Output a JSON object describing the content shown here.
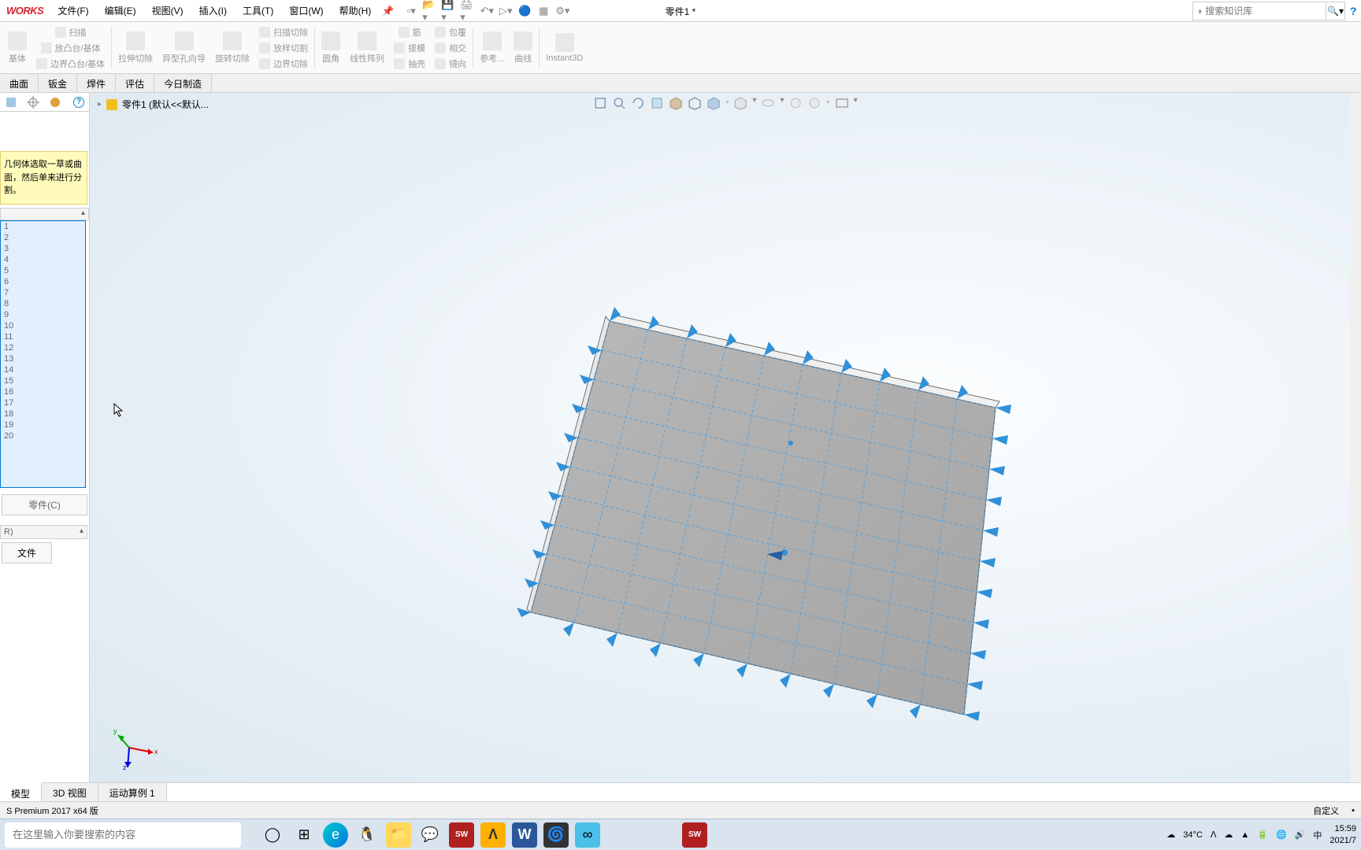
{
  "logo": "WORKS",
  "menu": [
    "文件(F)",
    "编辑(E)",
    "视图(V)",
    "插入(I)",
    "工具(T)",
    "窗口(W)",
    "帮助(H)"
  ],
  "pin": "📌",
  "doc_title": "零件1 *",
  "search": {
    "placeholder": "搜索知识库"
  },
  "ribbon": {
    "c1": [
      "扫描",
      "放凸台/基体",
      "边界凸台/基体"
    ],
    "c2": "拉伸切除",
    "c3": "异型孔向导",
    "c4": "旋转切除",
    "c5": [
      "扫描切除",
      "放样切割",
      "边界切除"
    ],
    "c6": "圆角",
    "c7": "线性阵列",
    "c8": [
      "筋",
      "拔模",
      "抽壳"
    ],
    "c9": [
      "包覆",
      "相交",
      "镜向"
    ],
    "c10": "参考...",
    "c11": "曲线",
    "c12": "Instant3D"
  },
  "ftabs": [
    "曲面",
    "钣金",
    "焊件",
    "评估",
    "今日制造"
  ],
  "crumb": "零件1 (默认<<默认...",
  "info": "几何体选取一草或曲面，然后单来进行分割。",
  "items": [
    "1",
    "2",
    "3",
    "4",
    "5",
    "6",
    "7",
    "8",
    "9",
    "10",
    "11",
    "12",
    "13",
    "14",
    "15",
    "16",
    "17",
    "18",
    "19",
    "20"
  ],
  "save_part": "零件(C)",
  "sec_r": "R)",
  "file_btn": "文件",
  "btabs": [
    "模型",
    "3D 视图",
    "运动算例 1"
  ],
  "status_left": "S Premium 2017 x64 版",
  "status_right": "自定义",
  "tb_search": "在这里输入你要搜索的内容",
  "temp": "34°C",
  "ime": "中",
  "time": "15:59",
  "date": "2021/7"
}
